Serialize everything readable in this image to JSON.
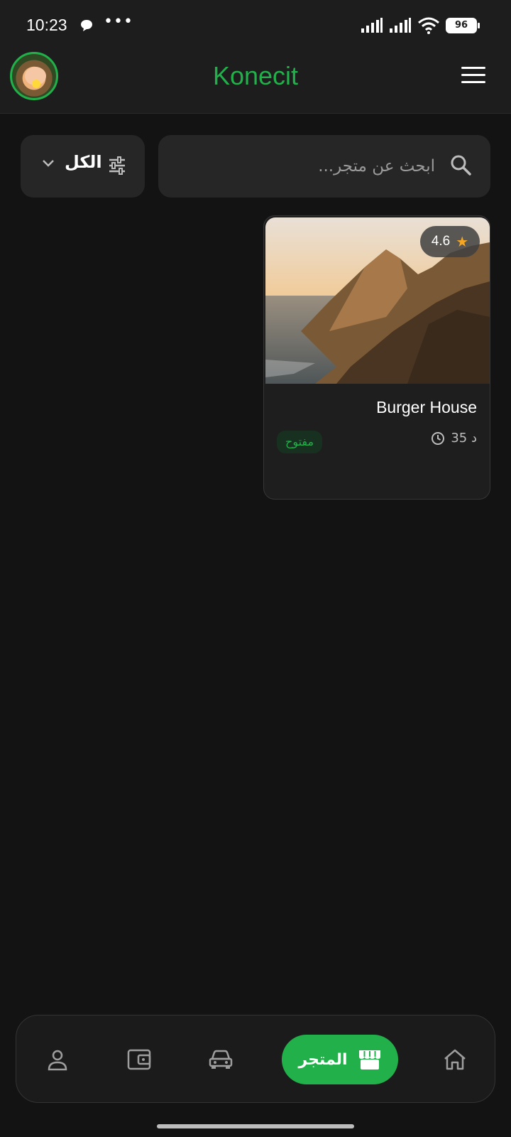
{
  "status_bar": {
    "time": "10:23",
    "battery": "96",
    "icons": [
      "chat-bubble-icon",
      "more-dots-icon",
      "signal-icon",
      "signal-icon",
      "wifi-icon",
      "battery-icon"
    ]
  },
  "header": {
    "title": "Konecit",
    "avatar_icon": "cat-avatar",
    "menu_icon": "hamburger-menu-icon"
  },
  "search": {
    "placeholder": "ابحث عن متجر...",
    "icon": "search-icon"
  },
  "filter": {
    "label": "الكل",
    "icons": [
      "tune-icon",
      "chevron-down-icon"
    ]
  },
  "stores": [
    {
      "name": "Burger House",
      "rating": "4.6",
      "time": "35 د",
      "status": "مفتوح",
      "image": "coastal-cliffs-sunset"
    }
  ],
  "bottom_nav": {
    "items": [
      {
        "icon": "home-icon"
      },
      {
        "icon": "store-icon",
        "label": "المتجر",
        "active": true
      },
      {
        "icon": "car-icon"
      },
      {
        "icon": "wallet-icon"
      },
      {
        "icon": "person-icon"
      }
    ]
  },
  "colors": {
    "accent": "#22b04b",
    "background": "#131313",
    "surface": "#262626",
    "star": "#f5a623"
  }
}
